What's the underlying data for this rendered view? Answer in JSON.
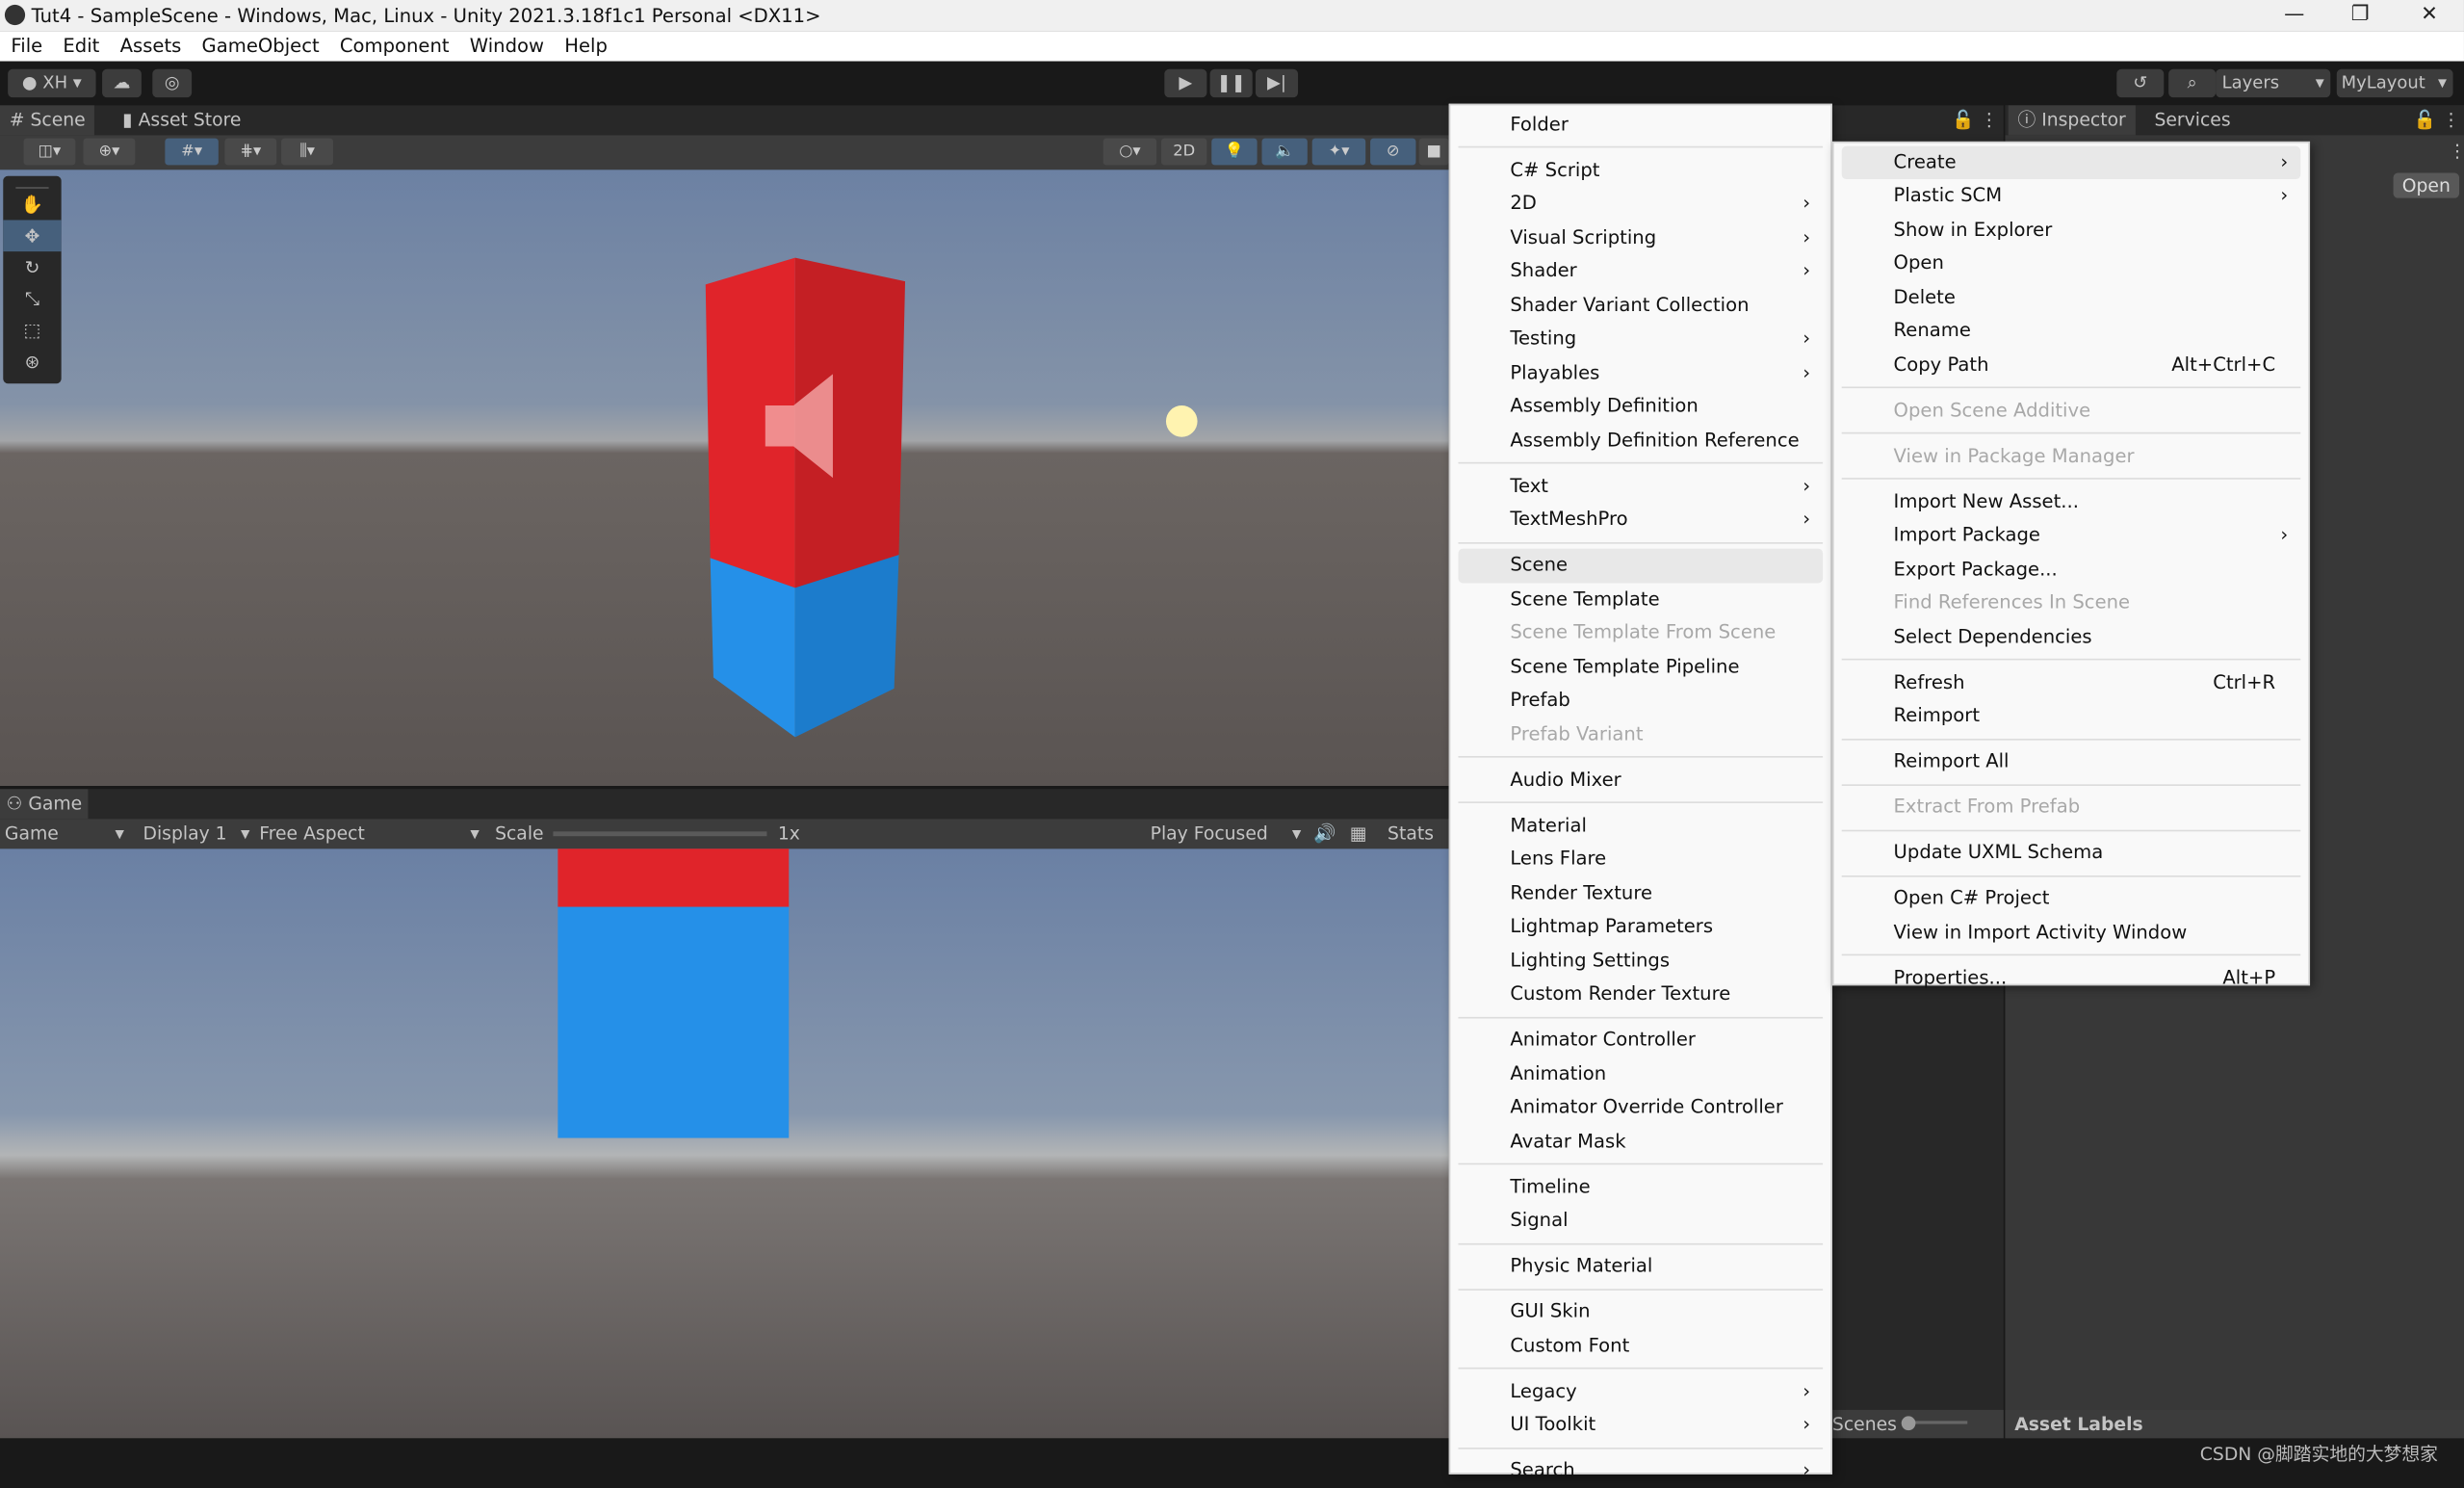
{
  "window": {
    "title": "Tut4 - SampleScene - Windows, Mac, Linux - Unity 2021.3.18f1c1 Personal <DX11>",
    "minimize": "—",
    "restore": "❐",
    "close": "✕"
  },
  "menubar": [
    "File",
    "Edit",
    "Assets",
    "GameObject",
    "Component",
    "Window",
    "Help"
  ],
  "toolbar": {
    "account": "XH",
    "layers": "Layers",
    "layout": "MyLayout"
  },
  "scene_tabs": [
    "Scene",
    "Asset Store"
  ],
  "scene_toolbar": {
    "mode_2d": "2D"
  },
  "game": {
    "tab": "Game",
    "view": "Game",
    "display": "Display 1",
    "aspect": "Free Aspect",
    "scale_label": "Scale",
    "scale_value": "1x",
    "play_mode": "Play Focused",
    "stats": "Stats"
  },
  "inspector": {
    "tabs": [
      "Inspector",
      "Services"
    ],
    "open_button": "Open",
    "asset_labels": "Asset Labels",
    "scenes_label": "Scenes"
  },
  "watermark": "CSDN @脚踏实地的大梦想家",
  "create_menu": [
    {
      "label": "Folder"
    },
    {
      "sep": true
    },
    {
      "label": "C# Script"
    },
    {
      "label": "2D",
      "sub": true
    },
    {
      "label": "Visual Scripting",
      "sub": true
    },
    {
      "label": "Shader",
      "sub": true
    },
    {
      "label": "Shader Variant Collection"
    },
    {
      "label": "Testing",
      "sub": true
    },
    {
      "label": "Playables",
      "sub": true
    },
    {
      "label": "Assembly Definition"
    },
    {
      "label": "Assembly Definition Reference"
    },
    {
      "sep": true
    },
    {
      "label": "Text",
      "sub": true
    },
    {
      "label": "TextMeshPro",
      "sub": true
    },
    {
      "sep": true
    },
    {
      "label": "Scene",
      "hover": true
    },
    {
      "label": "Scene Template"
    },
    {
      "label": "Scene Template From Scene",
      "disabled": true
    },
    {
      "label": "Scene Template Pipeline"
    },
    {
      "label": "Prefab"
    },
    {
      "label": "Prefab Variant",
      "disabled": true
    },
    {
      "sep": true
    },
    {
      "label": "Audio Mixer"
    },
    {
      "sep": true
    },
    {
      "label": "Material"
    },
    {
      "label": "Lens Flare"
    },
    {
      "label": "Render Texture"
    },
    {
      "label": "Lightmap Parameters"
    },
    {
      "label": "Lighting Settings"
    },
    {
      "label": "Custom Render Texture"
    },
    {
      "sep": true
    },
    {
      "label": "Animator Controller"
    },
    {
      "label": "Animation"
    },
    {
      "label": "Animator Override Controller"
    },
    {
      "label": "Avatar Mask"
    },
    {
      "sep": true
    },
    {
      "label": "Timeline"
    },
    {
      "label": "Signal"
    },
    {
      "sep": true
    },
    {
      "label": "Physic Material"
    },
    {
      "sep": true
    },
    {
      "label": "GUI Skin"
    },
    {
      "label": "Custom Font"
    },
    {
      "sep": true
    },
    {
      "label": "Legacy",
      "sub": true
    },
    {
      "label": "UI Toolkit",
      "sub": true
    },
    {
      "sep": true
    },
    {
      "label": "Search",
      "sub": true
    }
  ],
  "context_menu": [
    {
      "label": "Create",
      "sub": true,
      "hover": true
    },
    {
      "label": "Plastic SCM",
      "sub": true
    },
    {
      "label": "Show in Explorer"
    },
    {
      "label": "Open"
    },
    {
      "label": "Delete"
    },
    {
      "label": "Rename"
    },
    {
      "label": "Copy Path",
      "shortcut": "Alt+Ctrl+C"
    },
    {
      "sep": true
    },
    {
      "label": "Open Scene Additive",
      "disabled": true
    },
    {
      "sep": true
    },
    {
      "label": "View in Package Manager",
      "disabled": true
    },
    {
      "sep": true
    },
    {
      "label": "Import New Asset..."
    },
    {
      "label": "Import Package",
      "sub": true
    },
    {
      "label": "Export Package..."
    },
    {
      "label": "Find References In Scene",
      "disabled": true
    },
    {
      "label": "Select Dependencies"
    },
    {
      "sep": true
    },
    {
      "label": "Refresh",
      "shortcut": "Ctrl+R"
    },
    {
      "label": "Reimport"
    },
    {
      "sep": true
    },
    {
      "label": "Reimport All"
    },
    {
      "sep": true
    },
    {
      "label": "Extract From Prefab",
      "disabled": true
    },
    {
      "sep": true
    },
    {
      "label": "Update UXML Schema"
    },
    {
      "sep": true
    },
    {
      "label": "Open C# Project"
    },
    {
      "label": "View in Import Activity Window"
    },
    {
      "sep": true
    },
    {
      "label": "Properties...",
      "shortcut": "Alt+P"
    }
  ],
  "colors": {
    "cube_top": "#e0242a",
    "cube_bottom": "#1e88dc",
    "editor_bg": "#282828",
    "menu_bg": "#f9f9f9"
  }
}
